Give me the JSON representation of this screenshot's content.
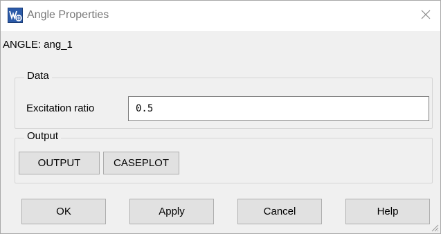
{
  "window": {
    "title": "Angle Properties",
    "app_icon": "app-logo-icon",
    "close_icon": "close-icon"
  },
  "entity": {
    "label": "ANGLE: ang_1"
  },
  "data_group": {
    "legend": "Data",
    "field_label": "Excitation ratio",
    "field_value": "0.5"
  },
  "output_group": {
    "legend": "Output",
    "buttons": [
      "OUTPUT",
      "CASEPLOT"
    ]
  },
  "actions": {
    "ok": "OK",
    "apply": "Apply",
    "cancel": "Cancel",
    "help": "Help"
  },
  "colors": {
    "dialog_bg": "#f0f0f0",
    "button_bg": "#e1e1e1",
    "button_border": "#adadad",
    "title_text": "#7a7a7a"
  }
}
